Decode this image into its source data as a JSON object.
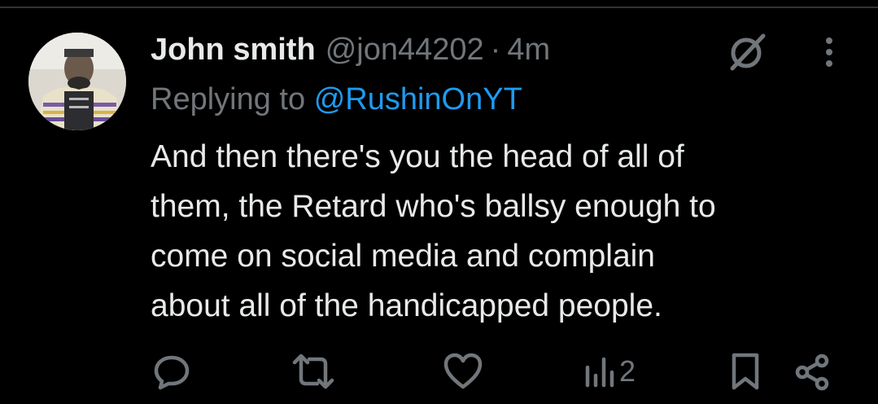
{
  "tweet": {
    "author": {
      "display_name": "John smith",
      "handle": "@jon44202",
      "separator": "·",
      "time": "4m",
      "avatar_icon": "profile-photo"
    },
    "reply": {
      "prefix": "Replying to",
      "to_handle": "@RushinOnYT"
    },
    "text_lines": [
      "And then there's you the head of all of",
      "them, the Retard who's ballsy enough to",
      "come on social media and complain",
      "about all of the handicapped people."
    ]
  },
  "actions": {
    "reply_icon": "speech-bubble",
    "retweet_icon": "repost-arrows",
    "like_icon": "heart",
    "views_icon": "bar-chart",
    "views_count": "2",
    "bookmark_icon": "bookmark",
    "share_icon": "share-nodes"
  },
  "header_icons": {
    "grok": "slashed-circle",
    "more": "vertical-ellipsis"
  },
  "colors": {
    "background": "#000000",
    "primary_text": "#e7e9ea",
    "secondary_text": "#71767b",
    "link": "#1d9bf0"
  }
}
